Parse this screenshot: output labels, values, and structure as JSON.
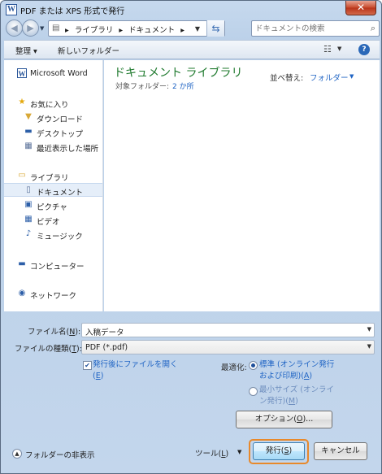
{
  "window": {
    "title": "PDF または XPS 形式で発行",
    "close_label": "✕",
    "icon_name": "word-app-icon"
  },
  "address": {
    "crumbs": [
      "ライブラリ",
      "ドキュメント"
    ],
    "separator": "▸"
  },
  "search": {
    "placeholder": "ドキュメントの検索"
  },
  "toolbar": {
    "organize_label": "整理 ▾",
    "new_folder_label": "新しいフォルダー"
  },
  "nav": {
    "word": "Microsoft Word",
    "favorites": "お気に入り",
    "downloads": "ダウンロード",
    "desktop": "デスクトップ",
    "recent": "最近表示した場所",
    "libraries": "ライブラリ",
    "documents": "ドキュメント",
    "pictures": "ピクチャ",
    "videos": "ビデオ",
    "music": "ミュージック",
    "computer": "コンピューター",
    "network": "ネットワーク"
  },
  "content": {
    "library_title": "ドキュメント ライブラリ",
    "target_label": "対象フォルダー:",
    "target_link": "2 か所",
    "sort_label": "並べ替え:",
    "sort_value": "フォルダー"
  },
  "form": {
    "filename_label": "ファイル名(",
    "filename_key": "N",
    "filename_tail": "):",
    "filename_value": "入稿データ",
    "filetype_label": "ファイルの種類(",
    "filetype_key": "T",
    "filetype_tail": "):",
    "filetype_value": "PDF (*.pdf)",
    "open_after_line1": "発行後にファイルを開く",
    "open_after_line2_pre": "(",
    "open_after_key": "E",
    "open_after_line2_post": ")",
    "optimize_label": "最適化:",
    "radio_standard_1": "標準 (オンライン発行",
    "radio_standard_2_pre": "および印刷)(",
    "radio_standard_key": "A",
    "radio_standard_2_post": ")",
    "radio_min_1": "最小サイズ (オンライ",
    "radio_min_2_pre": "ン発行)(",
    "radio_min_key": "M",
    "radio_min_2_post": ")",
    "options_pre": "オプション(",
    "options_key": "O",
    "options_post": ")..."
  },
  "footer": {
    "hide_folders": "フォルダーの非表示",
    "tools_pre": "ツール(",
    "tools_key": "L",
    "tools_post": ")",
    "publish_pre": "発行(",
    "publish_key": "S",
    "publish_post": ")",
    "cancel": "キャンセル"
  }
}
